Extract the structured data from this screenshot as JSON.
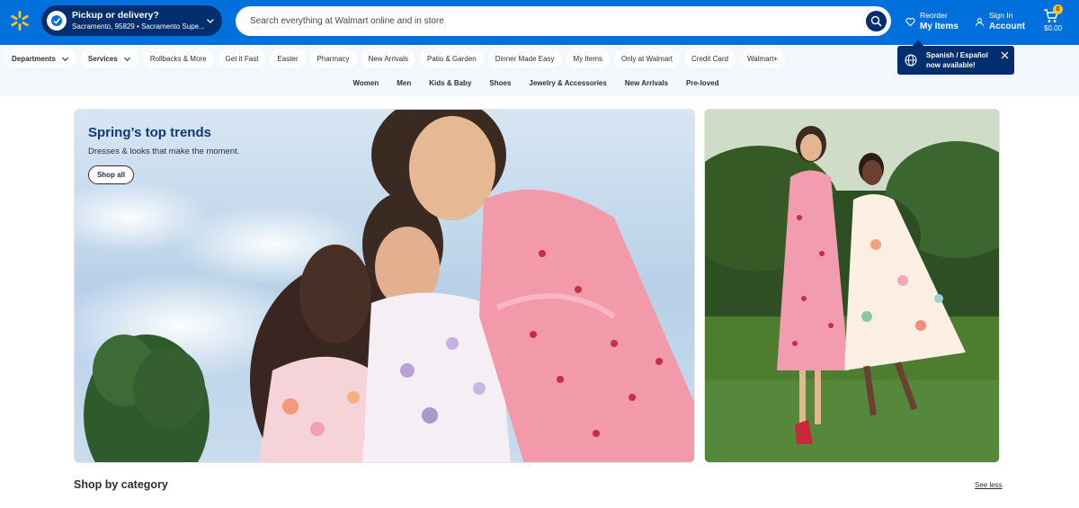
{
  "header": {
    "pickup": {
      "title": "Pickup or delivery?",
      "subtitle": "Sacramento, 95829 • Sacramento Supe..."
    },
    "search": {
      "placeholder": "Search everything at Walmart online and in store"
    },
    "reorder": {
      "top": "Reorder",
      "bottom": "My Items"
    },
    "account": {
      "top": "Sign In",
      "bottom": "Account"
    },
    "cart": {
      "count": "0",
      "total": "$0.00"
    }
  },
  "subnav": {
    "pills": [
      {
        "label": "Departments",
        "bold": true,
        "chevron": true
      },
      {
        "label": "Services",
        "bold": true,
        "chevron": true
      },
      {
        "label": "Rollbacks & More"
      },
      {
        "label": "Get it Fast"
      },
      {
        "label": "Easter"
      },
      {
        "label": "Pharmacy"
      },
      {
        "label": "New Arrivals"
      },
      {
        "label": "Patio & Garden"
      },
      {
        "label": "Dinner Made Easy"
      },
      {
        "label": "My Items"
      },
      {
        "label": "Only at Walmart"
      },
      {
        "label": "Credit Card"
      },
      {
        "label": "Walmart+"
      }
    ],
    "categories": [
      "Women",
      "Men",
      "Kids & Baby",
      "Shoes",
      "Jewelry & Accessories",
      "New Arrivals",
      "Pre-loved"
    ]
  },
  "toast": {
    "text": "Spanish / Español now available!"
  },
  "hero": {
    "title": "Spring’s top trends",
    "subtitle": "Dresses & looks that make the moment.",
    "button": "Shop all"
  },
  "section": {
    "title": "Shop by category",
    "link": "See less"
  },
  "colors": {
    "brand_blue": "#0071dc",
    "navy": "#002e6e",
    "spark_yellow": "#ffc220"
  }
}
